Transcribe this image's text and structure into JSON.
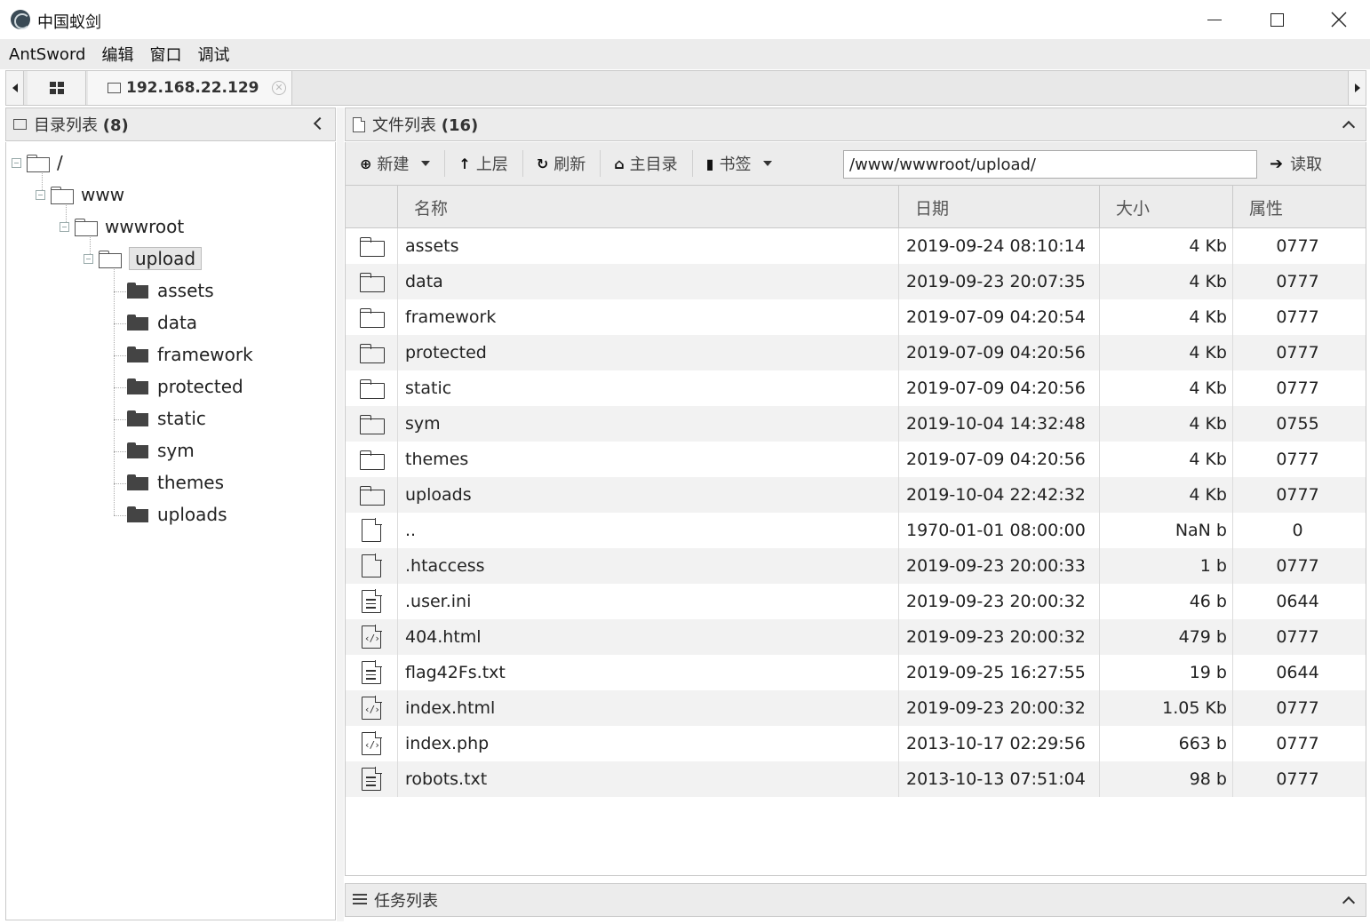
{
  "window": {
    "title": "中国蚁剑"
  },
  "menu": [
    "AntSword",
    "编辑",
    "窗口",
    "调试"
  ],
  "tabs": {
    "host": "192.168.22.129"
  },
  "dir_panel": {
    "title": "目录列表",
    "count": "(8)"
  },
  "tree": {
    "root": "/",
    "www": "www",
    "wwwroot": "wwwroot",
    "upload": "upload",
    "children": [
      "assets",
      "data",
      "framework",
      "protected",
      "static",
      "sym",
      "themes",
      "uploads"
    ]
  },
  "file_panel": {
    "title": "文件列表",
    "count": "(16)"
  },
  "toolbar": {
    "new_label": "新建",
    "up_label": "上层",
    "refresh_label": "刷新",
    "home_label": "主目录",
    "bookmark_label": "书签",
    "path_value": "/www/wwwroot/upload/",
    "read_label": "读取"
  },
  "columns": {
    "name": "名称",
    "date": "日期",
    "size": "大小",
    "attr": "属性"
  },
  "files": [
    {
      "type": "folder",
      "name": "assets",
      "date": "2019-09-24 08:10:14",
      "size": "4 Kb",
      "attr": "0777"
    },
    {
      "type": "folder",
      "name": "data",
      "date": "2019-09-23 20:07:35",
      "size": "4 Kb",
      "attr": "0777"
    },
    {
      "type": "folder",
      "name": "framework",
      "date": "2019-07-09 04:20:54",
      "size": "4 Kb",
      "attr": "0777"
    },
    {
      "type": "folder",
      "name": "protected",
      "date": "2019-07-09 04:20:56",
      "size": "4 Kb",
      "attr": "0777"
    },
    {
      "type": "folder",
      "name": "static",
      "date": "2019-07-09 04:20:56",
      "size": "4 Kb",
      "attr": "0777"
    },
    {
      "type": "folder",
      "name": "sym",
      "date": "2019-10-04 14:32:48",
      "size": "4 Kb",
      "attr": "0755"
    },
    {
      "type": "folder",
      "name": "themes",
      "date": "2019-07-09 04:20:56",
      "size": "4 Kb",
      "attr": "0777"
    },
    {
      "type": "folder",
      "name": "uploads",
      "date": "2019-10-04 22:42:32",
      "size": "4 Kb",
      "attr": "0777"
    },
    {
      "type": "file",
      "name": "..",
      "date": "1970-01-01 08:00:00",
      "size": "NaN b",
      "attr": "0"
    },
    {
      "type": "file",
      "name": ".htaccess",
      "date": "2019-09-23 20:00:33",
      "size": "1 b",
      "attr": "0777"
    },
    {
      "type": "text",
      "name": ".user.ini",
      "date": "2019-09-23 20:00:32",
      "size": "46 b",
      "attr": "0644"
    },
    {
      "type": "code",
      "name": "404.html",
      "date": "2019-09-23 20:00:32",
      "size": "479 b",
      "attr": "0777"
    },
    {
      "type": "text",
      "name": "flag42Fs.txt",
      "date": "2019-09-25 16:27:55",
      "size": "19 b",
      "attr": "0644"
    },
    {
      "type": "code",
      "name": "index.html",
      "date": "2019-09-23 20:00:32",
      "size": "1.05 Kb",
      "attr": "0777"
    },
    {
      "type": "code",
      "name": "index.php",
      "date": "2013-10-17 02:29:56",
      "size": "663 b",
      "attr": "0777"
    },
    {
      "type": "text",
      "name": "robots.txt",
      "date": "2013-10-13 07:51:04",
      "size": "98 b",
      "attr": "0777"
    }
  ],
  "task_panel": {
    "title": "任务列表"
  }
}
